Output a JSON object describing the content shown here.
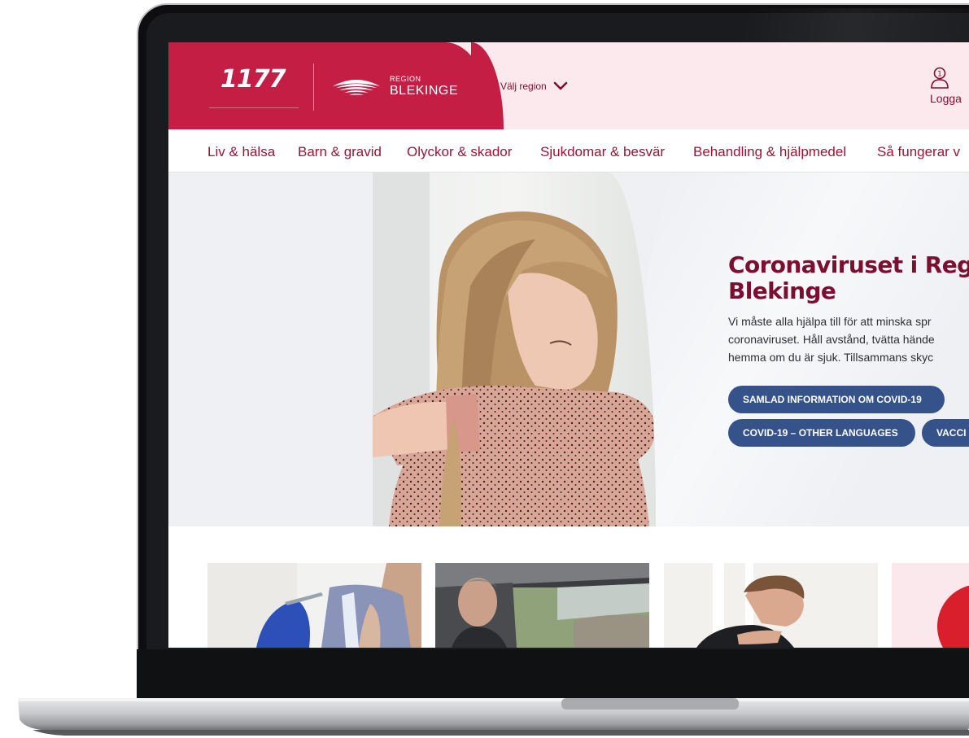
{
  "header": {
    "logo_1177": "1177",
    "region_small": "REGION",
    "region_name": "BLEKINGE",
    "select_region": "Välj region",
    "login_label": "Logga"
  },
  "nav": {
    "items": [
      "Liv & hälsa",
      "Barn & gravid",
      "Olyckor & skador",
      "Sjukdomar & besvär",
      "Behandling & hjälpmedel",
      "Så fungerar v"
    ]
  },
  "hero": {
    "title_line1": "Coronaviruset i Regio",
    "title_line2": "Blekinge",
    "text_line1": "Vi måste alla hjälpa till för att minska spr",
    "text_line2": "coronaviruset. Håll avstånd, tvätta hände",
    "text_line3": "hemma om du är sjuk. Tillsammans skyc",
    "buttons": [
      "SAMLAD INFORMATION OM COVID-19",
      "COVID-19 – OTHER LANGUAGES",
      "VACCI"
    ]
  },
  "colors": {
    "brand_red": "#c41e44",
    "nav_text": "#9a1436",
    "title": "#7b0f30",
    "pill": "#35538a"
  }
}
